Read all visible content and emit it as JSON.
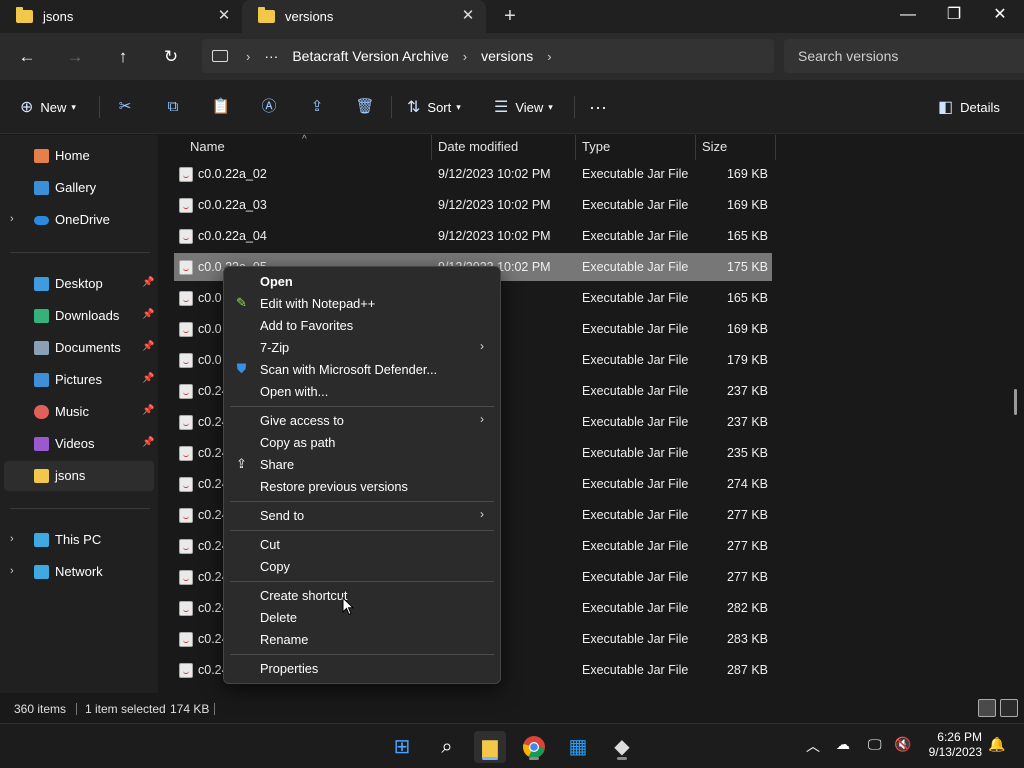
{
  "tabs": [
    {
      "label": "jsons"
    },
    {
      "label": "versions"
    }
  ],
  "address": {
    "crumbs": [
      "Betacraft Version Archive",
      "versions"
    ],
    "search_placeholder": "Search versions"
  },
  "commands": {
    "new": "New",
    "sort": "Sort",
    "view": "View",
    "details": "Details"
  },
  "sidebar": {
    "items": [
      {
        "label": "Home",
        "icon": "home-icon",
        "color": "#e6804b"
      },
      {
        "label": "Gallery",
        "icon": "gallery-icon",
        "color": "#3b8ed8"
      },
      {
        "label": "OneDrive",
        "icon": "cloud-icon",
        "color": "#2a8ae0"
      },
      {
        "label": "Desktop",
        "icon": "desktop-icon",
        "color": "#3f9be0"
      },
      {
        "label": "Downloads",
        "icon": "download-icon",
        "color": "#35b27a"
      },
      {
        "label": "Documents",
        "icon": "documents-icon",
        "color": "#8aa0b4"
      },
      {
        "label": "Pictures",
        "icon": "pictures-icon",
        "color": "#3f8fd8"
      },
      {
        "label": "Music",
        "icon": "music-icon",
        "color": "#e0605a"
      },
      {
        "label": "Videos",
        "icon": "videos-icon",
        "color": "#9b59d0"
      },
      {
        "label": "jsons",
        "icon": "folder-icon",
        "color": "#f2c84b"
      },
      {
        "label": "This PC",
        "icon": "pc-icon",
        "color": "#3fa9e0"
      },
      {
        "label": "Network",
        "icon": "network-icon",
        "color": "#3fa9e0"
      }
    ]
  },
  "columns": {
    "name": "Name",
    "date": "Date modified",
    "type": "Type",
    "size": "Size"
  },
  "files": [
    {
      "name": "c0.0.22a_02",
      "date": "9/12/2023 10:02 PM",
      "type": "Executable Jar File",
      "size": "169 KB"
    },
    {
      "name": "c0.0.22a_03",
      "date": "9/12/2023 10:02 PM",
      "type": "Executable Jar File",
      "size": "169 KB"
    },
    {
      "name": "c0.0.22a_04",
      "date": "9/12/2023 10:02 PM",
      "type": "Executable Jar File",
      "size": "165 KB"
    },
    {
      "name": "c0.0.22a_05",
      "date": "9/12/2023 10:02 PM",
      "type": "Executable Jar File",
      "size": "175 KB"
    },
    {
      "name": "c0.0",
      "date": "02 PM",
      "type": "Executable Jar File",
      "size": "165 KB"
    },
    {
      "name": "c0.0",
      "date": "02 PM",
      "type": "Executable Jar File",
      "size": "169 KB"
    },
    {
      "name": "c0.0",
      "date": "02 PM",
      "type": "Executable Jar File",
      "size": "179 KB"
    },
    {
      "name": "c0.24",
      "date": "02 PM",
      "type": "Executable Jar File",
      "size": "237 KB"
    },
    {
      "name": "c0.24",
      "date": "02 PM",
      "type": "Executable Jar File",
      "size": "237 KB"
    },
    {
      "name": "c0.24",
      "date": "02 PM",
      "type": "Executable Jar File",
      "size": "235 KB"
    },
    {
      "name": "c0.24",
      "date": "02 PM",
      "type": "Executable Jar File",
      "size": "274 KB"
    },
    {
      "name": "c0.24",
      "date": "02 PM",
      "type": "Executable Jar File",
      "size": "277 KB"
    },
    {
      "name": "c0.24",
      "date": "02 PM",
      "type": "Executable Jar File",
      "size": "277 KB"
    },
    {
      "name": "c0.24",
      "date": "02 PM",
      "type": "Executable Jar File",
      "size": "277 KB"
    },
    {
      "name": "c0.24",
      "date": "02 PM",
      "type": "Executable Jar File",
      "size": "282 KB"
    },
    {
      "name": "c0.24",
      "date": "02 PM",
      "type": "Executable Jar File",
      "size": "283 KB"
    },
    {
      "name": "c0.24",
      "date": "02 PM",
      "type": "Executable Jar File",
      "size": "287 KB"
    }
  ],
  "context_menu": {
    "items": [
      {
        "label": "Open",
        "bold": true
      },
      {
        "label": "Edit with Notepad++",
        "icon": "notepadpp-icon"
      },
      {
        "label": "Add to Favorites"
      },
      {
        "label": "7-Zip",
        "submenu": true
      },
      {
        "label": "Scan with Microsoft Defender...",
        "icon": "defender-icon"
      },
      {
        "label": "Open with..."
      },
      {
        "label": "Give access to",
        "submenu": true
      },
      {
        "label": "Copy as path"
      },
      {
        "label": "Share",
        "icon": "share-icon"
      },
      {
        "label": "Restore previous versions"
      },
      {
        "label": "Send to",
        "submenu": true
      },
      {
        "label": "Cut"
      },
      {
        "label": "Copy"
      },
      {
        "label": "Create shortcut"
      },
      {
        "label": "Delete"
      },
      {
        "label": "Rename"
      },
      {
        "label": "Properties"
      }
    ]
  },
  "status": {
    "items": "360 items",
    "selected": "1 item selected",
    "size": "174 KB"
  },
  "clock": {
    "time": "6:26 PM",
    "date": "9/13/2023"
  }
}
